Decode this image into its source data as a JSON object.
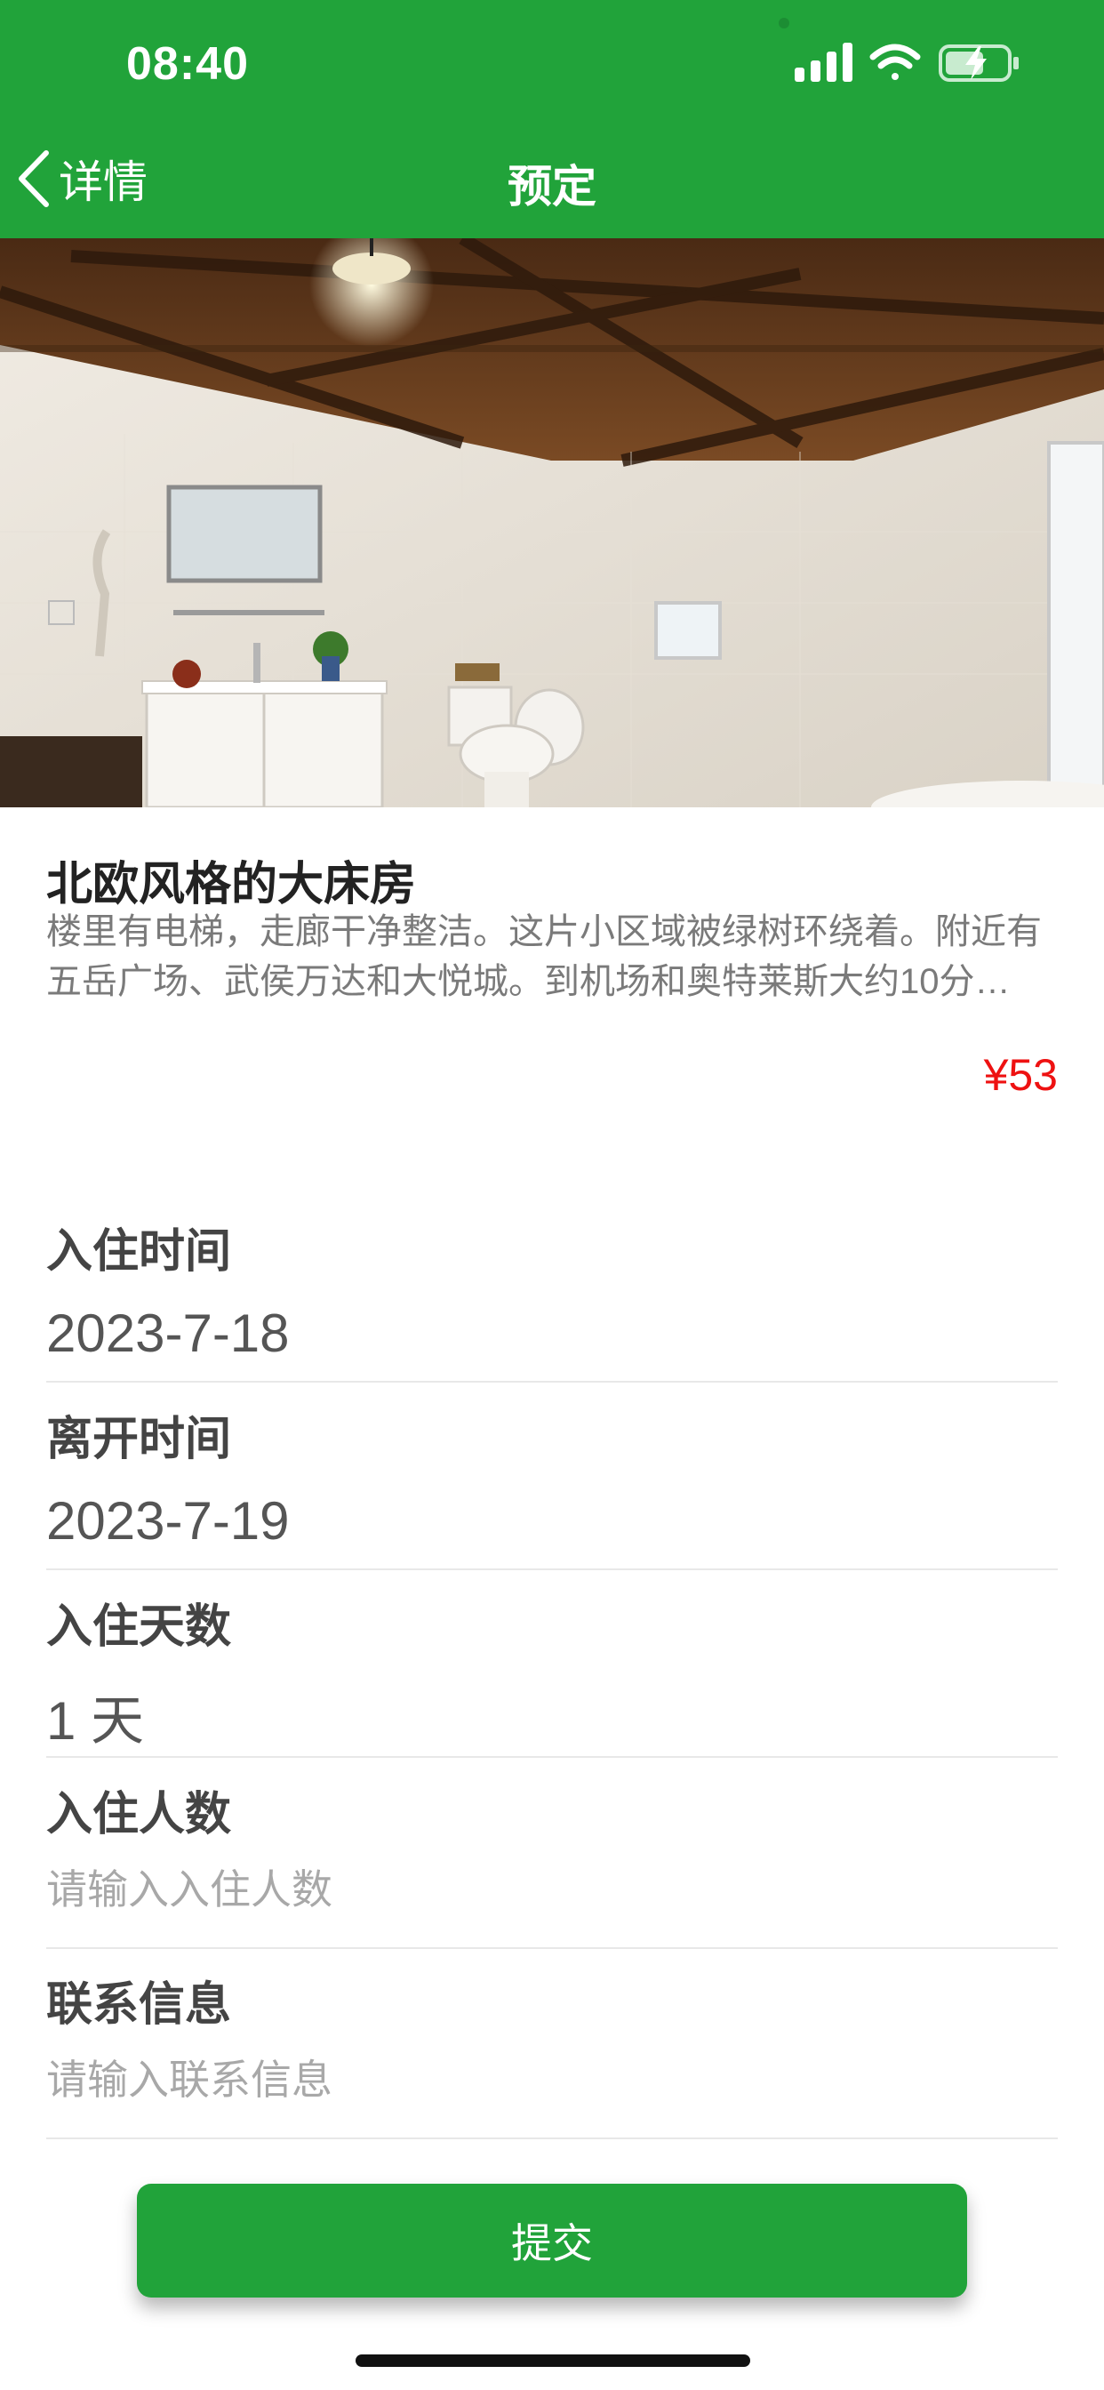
{
  "status_bar": {
    "time": "08:40"
  },
  "nav": {
    "back_label": "详情",
    "title": "预定"
  },
  "room": {
    "title": "北欧风格的大床房",
    "description": "楼里有电梯，走廊干净整洁。这片小区域被绿树环绕着。附近有五岳广场、武侯万达和大悦城。到机场和奥特莱斯大约10分…",
    "price": "¥53"
  },
  "form": {
    "check_in": {
      "label": "入住时间",
      "value": "2023-7-18"
    },
    "check_out": {
      "label": "离开时间",
      "value": "2023-7-19"
    },
    "nights": {
      "label": "入住天数",
      "value": "1 天"
    },
    "guests": {
      "label": "入住人数",
      "placeholder": "请输入入住人数"
    },
    "contact": {
      "label": "联系信息",
      "placeholder": "请输入联系信息"
    }
  },
  "submit_label": "提交",
  "colors": {
    "brand": "#21a33a",
    "price": "#ee1111"
  }
}
